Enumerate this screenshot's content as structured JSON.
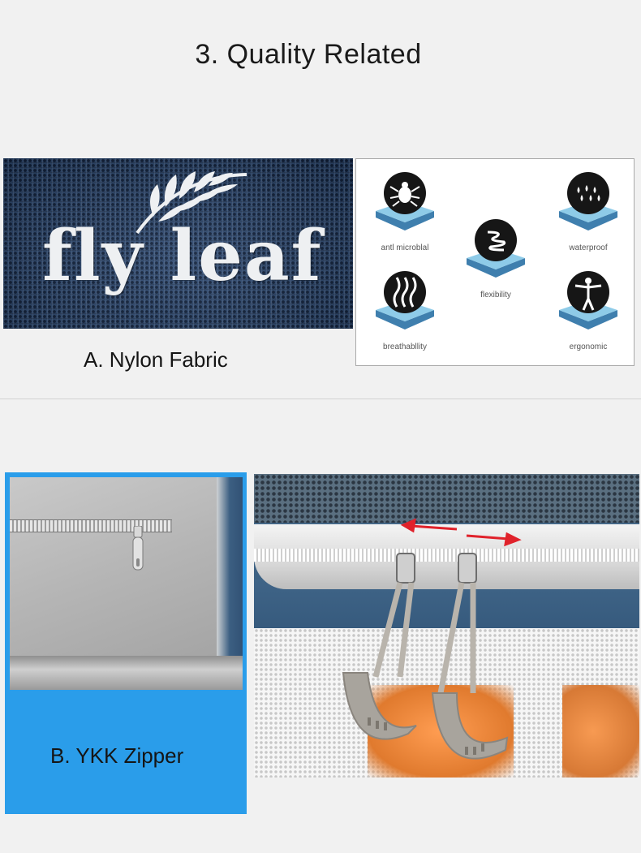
{
  "section": {
    "title": "3. Quality Related"
  },
  "fabric": {
    "brand_text": "fly leaf",
    "caption": "A. Nylon Fabric"
  },
  "features": [
    {
      "label": "antl microblal",
      "icon": "bug-icon"
    },
    {
      "label": "flexibility",
      "icon": "spring-icon"
    },
    {
      "label": "waterproof",
      "icon": "water-drops-icon"
    },
    {
      "label": "breathabllity",
      "icon": "steam-waves-icon"
    },
    {
      "label": "ergonomic",
      "icon": "human-figure-icon"
    }
  ],
  "zipper": {
    "caption": "B. YKK Zipper"
  },
  "colors": {
    "background": "#f1f1f1",
    "card_blue": "#2a9dea",
    "fabric_blue": "#2f4b73",
    "arrow_red": "#e0222b"
  }
}
